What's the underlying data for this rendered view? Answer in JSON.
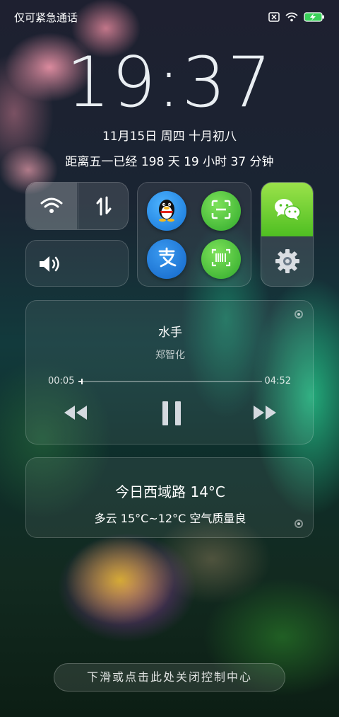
{
  "status_bar": {
    "carrier_text": "仅可紧急通话",
    "battery_state": "charging",
    "accent_battery": "#3ad15a"
  },
  "lockscreen": {
    "time": "19:37",
    "date": "11月15日 周四 十月初八",
    "countdown": "距离五一已经 198 天 19 小时 37 分钟"
  },
  "toggles": {
    "wifi": "wifi-icon",
    "data": "mobile-data-icon",
    "sound": "speaker-icon"
  },
  "shortcuts": {
    "apps": [
      {
        "name": "QQ",
        "icon": "qq-penguin-icon",
        "color": "#1f8ee8"
      },
      {
        "name": "scan",
        "icon": "scan-icon",
        "color": "#3fc43c"
      },
      {
        "name": "alipay",
        "icon": "alipay-icon",
        "color": "#1877d9"
      },
      {
        "name": "barcode",
        "icon": "barcode-icon",
        "color": "#3fc43c"
      }
    ],
    "wechat_color": "#5ecf2a"
  },
  "music": {
    "title": "水手",
    "artist": "郑智化",
    "elapsed": "00:05",
    "duration": "04:52",
    "progress": 0.017
  },
  "weather": {
    "headline": "今日西域路 14°C",
    "detail": "多云 15°C~12°C 空气质量良"
  },
  "footer": {
    "hint": "下滑或点击此处关闭控制中心"
  }
}
